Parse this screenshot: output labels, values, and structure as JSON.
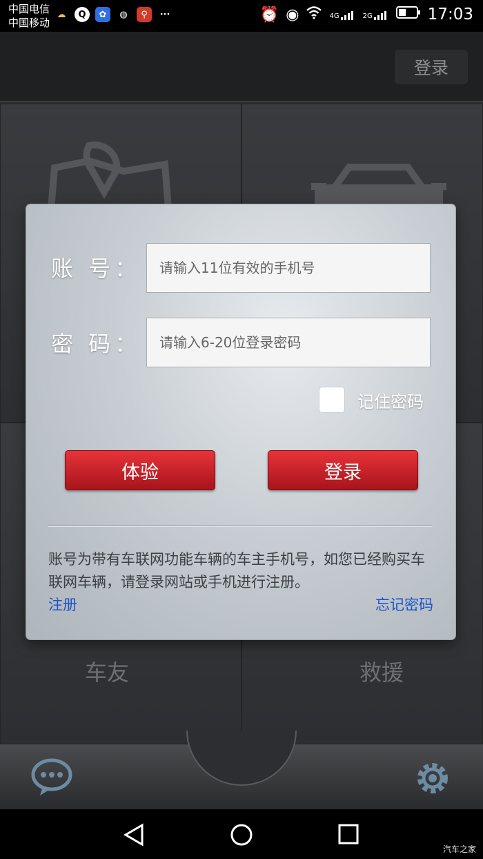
{
  "status_bar": {
    "carrier_1": "中国电信",
    "carrier_2": "中国移动",
    "network_4g": "4G",
    "network_2g": "2G",
    "time": "17:03"
  },
  "header": {
    "login_label": "登录"
  },
  "tiles": {
    "friends_label": "车友",
    "rescue_label": "救援"
  },
  "dialog": {
    "account_label": "账 号：",
    "account_placeholder": "请输入11位有效的手机号",
    "password_label": "密 码：",
    "password_placeholder": "请输入6-20位登录密码",
    "remember_label": "记住密码",
    "remember_checked": false,
    "trial_button": "体验",
    "login_button": "登录",
    "info_text": "账号为带有车联网功能车辆的车主手机号，如您已经购买车联网车辆，请登录网站或手机进行注册。",
    "register_link": "注册",
    "forgot_link": "忘记密码"
  },
  "colors": {
    "accent_red": "#d4212a",
    "link_blue": "#1a53c9"
  },
  "watermark": "汽车之家"
}
